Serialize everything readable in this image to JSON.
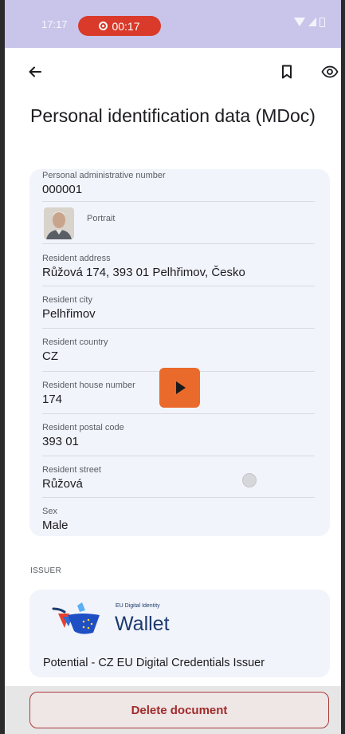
{
  "status_bar": {
    "time": "17:17",
    "recording_time": "00:17"
  },
  "page": {
    "title": "Personal identification data (MDoc)"
  },
  "fields": {
    "admin_number": {
      "label": "Personal administrative number",
      "value": "000001"
    },
    "portrait": {
      "label": "Portrait"
    },
    "address": {
      "label": "Resident address",
      "value": "Růžová 174, 393 01 Pelhřimov, Česko"
    },
    "city": {
      "label": "Resident city",
      "value": "Pelhřimov"
    },
    "country": {
      "label": "Resident country",
      "value": "CZ"
    },
    "house_number": {
      "label": "Resident house number",
      "value": "174"
    },
    "postal_code": {
      "label": "Resident postal code",
      "value": "393 01"
    },
    "street": {
      "label": "Resident street",
      "value": "Růžová"
    },
    "sex": {
      "label": "Sex",
      "value": "Male"
    }
  },
  "issuer": {
    "section_label": "ISSUER",
    "logo_caption": "EU Digital Identity",
    "logo_word": "Wallet",
    "name": "Potential - CZ EU Digital Credentials Issuer"
  },
  "actions": {
    "delete_label": "Delete document"
  },
  "icons": [
    "back-arrow-icon",
    "bookmark-icon",
    "eye-icon",
    "play-icon",
    "record-icon"
  ],
  "colors": {
    "status_bar": "#c9c5ea",
    "record_pill": "#d93a2a",
    "card": "#f1f4fa",
    "play_button": "#ea6a2b",
    "delete": "#a93b3a",
    "wallet_blue": "#1d3a6e"
  }
}
